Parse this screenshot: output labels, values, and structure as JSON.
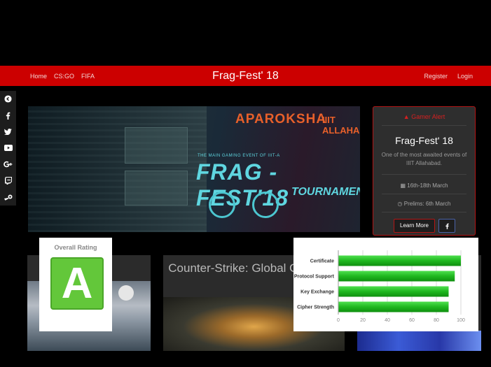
{
  "nav": {
    "left_links": [
      "Home",
      "CS:GO",
      "FIFA"
    ],
    "brand": "Frag-Fest' 18",
    "right_links": [
      "Register",
      "Login"
    ],
    "colors": {
      "bar": "#cc0000"
    }
  },
  "social": {
    "icons": [
      "share-icon",
      "facebook-icon",
      "twitter-icon",
      "youtube-icon",
      "google-plus-icon",
      "twitch-icon",
      "steam-icon"
    ]
  },
  "banner": {
    "org": "APAROKSHA",
    "institute": "IIIT ALLAHABAD",
    "tagline": "THE MAIN GAMING EVENT OF IIIT-A",
    "title": "FRAG - FEST'18",
    "subtitle": "TOURNAMENT"
  },
  "sidecard": {
    "alert": "Gamer Alert",
    "title": "Frag-Fest' 18",
    "description": "One of the most awaited events of IIIT Allahabad.",
    "dates": "16th-18th March",
    "prelims": "Prelims: 6th March",
    "learn_more": "Learn More"
  },
  "cards": {
    "csgo_title": "Counter-Strike: Global Offensive"
  },
  "rating": {
    "label": "Overall Rating",
    "grade": "A",
    "color": "#63c73a"
  },
  "chart_data": {
    "type": "bar",
    "orientation": "horizontal",
    "categories": [
      "Certificate",
      "Protocol Support",
      "Key Exchange",
      "Cipher Strength"
    ],
    "values": [
      100,
      95,
      90,
      90
    ],
    "xlim": [
      0,
      100
    ],
    "xticks": [
      0,
      20,
      40,
      60,
      80,
      100
    ],
    "grid": true,
    "bar_color": "#1fb81f"
  }
}
